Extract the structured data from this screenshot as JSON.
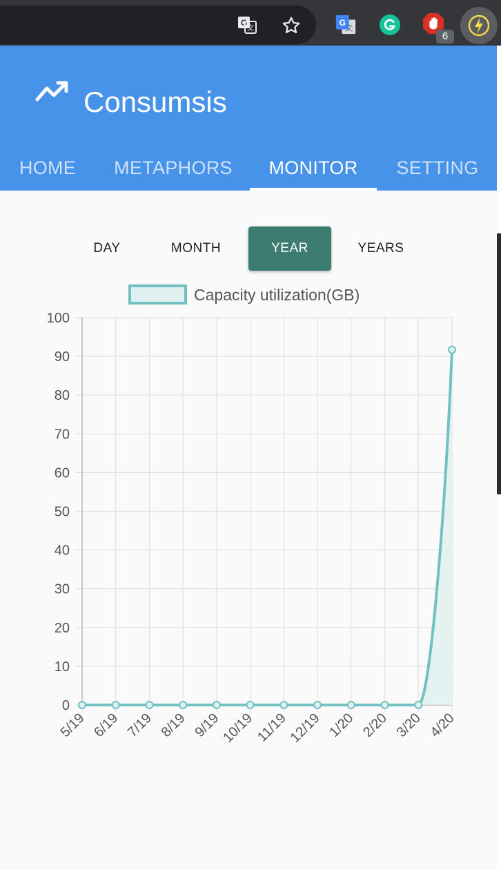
{
  "browser": {
    "omnibox_icons": [
      "translate-icon",
      "bookmark-star-icon"
    ],
    "extensions": [
      {
        "name": "google-translate-icon"
      },
      {
        "name": "grammarly-icon"
      },
      {
        "name": "adblock-icon",
        "badge": "6"
      },
      {
        "name": "consumsis-extension-icon"
      }
    ]
  },
  "app": {
    "title": "Consumsis",
    "brand_color": "#4793ea",
    "nav": [
      "HOME",
      "METAPHORS",
      "MONITOR",
      "SETTING"
    ],
    "active_nav": "MONITOR"
  },
  "range": {
    "options": [
      "DAY",
      "MONTH",
      "YEAR",
      "YEARS"
    ],
    "selected": "YEAR",
    "selected_color": "#3d7d71"
  },
  "chart_data": {
    "type": "area",
    "categories": [
      "5/19",
      "6/19",
      "7/19",
      "8/19",
      "9/19",
      "10/19",
      "11/19",
      "12/19",
      "1/20",
      "2/20",
      "3/20",
      "4/20"
    ],
    "series": [
      {
        "name": "Capacity utilization(GB)",
        "values": [
          0,
          0,
          0,
          0,
          0,
          0,
          0,
          0,
          0,
          0,
          0,
          91.7
        ],
        "color": "#72c1c0",
        "fill": "#dff0f0"
      }
    ],
    "yticks": [
      0,
      10,
      20,
      30,
      40,
      50,
      60,
      70,
      80,
      90,
      100
    ],
    "ylim": [
      0,
      100
    ],
    "grid": true,
    "legend": "top"
  }
}
